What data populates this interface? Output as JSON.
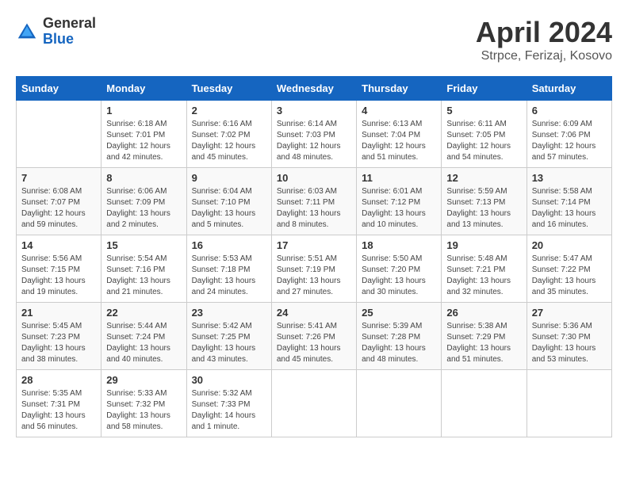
{
  "header": {
    "logo_general": "General",
    "logo_blue": "Blue",
    "title": "April 2024",
    "location": "Strpce, Ferizaj, Kosovo"
  },
  "weekdays": [
    "Sunday",
    "Monday",
    "Tuesday",
    "Wednesday",
    "Thursday",
    "Friday",
    "Saturday"
  ],
  "weeks": [
    [
      {
        "day": "",
        "info": ""
      },
      {
        "day": "1",
        "info": "Sunrise: 6:18 AM\nSunset: 7:01 PM\nDaylight: 12 hours\nand 42 minutes."
      },
      {
        "day": "2",
        "info": "Sunrise: 6:16 AM\nSunset: 7:02 PM\nDaylight: 12 hours\nand 45 minutes."
      },
      {
        "day": "3",
        "info": "Sunrise: 6:14 AM\nSunset: 7:03 PM\nDaylight: 12 hours\nand 48 minutes."
      },
      {
        "day": "4",
        "info": "Sunrise: 6:13 AM\nSunset: 7:04 PM\nDaylight: 12 hours\nand 51 minutes."
      },
      {
        "day": "5",
        "info": "Sunrise: 6:11 AM\nSunset: 7:05 PM\nDaylight: 12 hours\nand 54 minutes."
      },
      {
        "day": "6",
        "info": "Sunrise: 6:09 AM\nSunset: 7:06 PM\nDaylight: 12 hours\nand 57 minutes."
      }
    ],
    [
      {
        "day": "7",
        "info": "Sunrise: 6:08 AM\nSunset: 7:07 PM\nDaylight: 12 hours\nand 59 minutes."
      },
      {
        "day": "8",
        "info": "Sunrise: 6:06 AM\nSunset: 7:09 PM\nDaylight: 13 hours\nand 2 minutes."
      },
      {
        "day": "9",
        "info": "Sunrise: 6:04 AM\nSunset: 7:10 PM\nDaylight: 13 hours\nand 5 minutes."
      },
      {
        "day": "10",
        "info": "Sunrise: 6:03 AM\nSunset: 7:11 PM\nDaylight: 13 hours\nand 8 minutes."
      },
      {
        "day": "11",
        "info": "Sunrise: 6:01 AM\nSunset: 7:12 PM\nDaylight: 13 hours\nand 10 minutes."
      },
      {
        "day": "12",
        "info": "Sunrise: 5:59 AM\nSunset: 7:13 PM\nDaylight: 13 hours\nand 13 minutes."
      },
      {
        "day": "13",
        "info": "Sunrise: 5:58 AM\nSunset: 7:14 PM\nDaylight: 13 hours\nand 16 minutes."
      }
    ],
    [
      {
        "day": "14",
        "info": "Sunrise: 5:56 AM\nSunset: 7:15 PM\nDaylight: 13 hours\nand 19 minutes."
      },
      {
        "day": "15",
        "info": "Sunrise: 5:54 AM\nSunset: 7:16 PM\nDaylight: 13 hours\nand 21 minutes."
      },
      {
        "day": "16",
        "info": "Sunrise: 5:53 AM\nSunset: 7:18 PM\nDaylight: 13 hours\nand 24 minutes."
      },
      {
        "day": "17",
        "info": "Sunrise: 5:51 AM\nSunset: 7:19 PM\nDaylight: 13 hours\nand 27 minutes."
      },
      {
        "day": "18",
        "info": "Sunrise: 5:50 AM\nSunset: 7:20 PM\nDaylight: 13 hours\nand 30 minutes."
      },
      {
        "day": "19",
        "info": "Sunrise: 5:48 AM\nSunset: 7:21 PM\nDaylight: 13 hours\nand 32 minutes."
      },
      {
        "day": "20",
        "info": "Sunrise: 5:47 AM\nSunset: 7:22 PM\nDaylight: 13 hours\nand 35 minutes."
      }
    ],
    [
      {
        "day": "21",
        "info": "Sunrise: 5:45 AM\nSunset: 7:23 PM\nDaylight: 13 hours\nand 38 minutes."
      },
      {
        "day": "22",
        "info": "Sunrise: 5:44 AM\nSunset: 7:24 PM\nDaylight: 13 hours\nand 40 minutes."
      },
      {
        "day": "23",
        "info": "Sunrise: 5:42 AM\nSunset: 7:25 PM\nDaylight: 13 hours\nand 43 minutes."
      },
      {
        "day": "24",
        "info": "Sunrise: 5:41 AM\nSunset: 7:26 PM\nDaylight: 13 hours\nand 45 minutes."
      },
      {
        "day": "25",
        "info": "Sunrise: 5:39 AM\nSunset: 7:28 PM\nDaylight: 13 hours\nand 48 minutes."
      },
      {
        "day": "26",
        "info": "Sunrise: 5:38 AM\nSunset: 7:29 PM\nDaylight: 13 hours\nand 51 minutes."
      },
      {
        "day": "27",
        "info": "Sunrise: 5:36 AM\nSunset: 7:30 PM\nDaylight: 13 hours\nand 53 minutes."
      }
    ],
    [
      {
        "day": "28",
        "info": "Sunrise: 5:35 AM\nSunset: 7:31 PM\nDaylight: 13 hours\nand 56 minutes."
      },
      {
        "day": "29",
        "info": "Sunrise: 5:33 AM\nSunset: 7:32 PM\nDaylight: 13 hours\nand 58 minutes."
      },
      {
        "day": "30",
        "info": "Sunrise: 5:32 AM\nSunset: 7:33 PM\nDaylight: 14 hours\nand 1 minute."
      },
      {
        "day": "",
        "info": ""
      },
      {
        "day": "",
        "info": ""
      },
      {
        "day": "",
        "info": ""
      },
      {
        "day": "",
        "info": ""
      }
    ]
  ]
}
